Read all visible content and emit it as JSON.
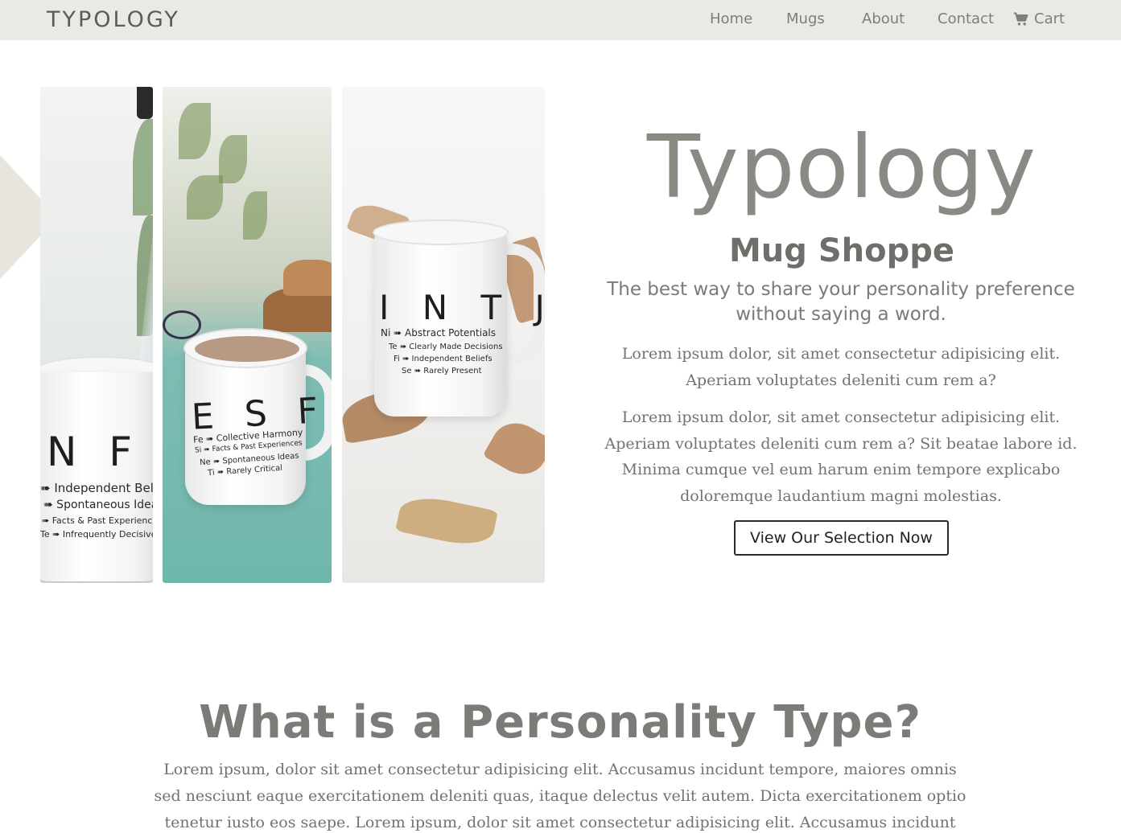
{
  "nav": {
    "brand": "TYPOLOGY",
    "links": [
      "Home",
      "Mugs",
      "About",
      "Contact"
    ],
    "cart": "Cart"
  },
  "mugs": {
    "nfp": {
      "letters": "N F P",
      "lines": [
        "➠ Independent Beliefs",
        "➠ Spontaneous Ideas",
        "➠ Facts & Past Experiences",
        "Te ➠ Infrequently Decisive"
      ]
    },
    "esfj": {
      "letters": "E S F J",
      "lines": [
        "Fe ➠ Collective Harmony",
        "Si ➠ Facts & Past Experiences",
        "Ne ➠ Spontaneous Ideas",
        "Ti ➠ Rarely Critical"
      ]
    },
    "intj": {
      "letters": "I N T J",
      "lines": [
        "Ni ➠ Abstract Potentials",
        "Te ➠ Clearly Made Decisions",
        "Fi ➠ Independent Beliefs",
        "Se ➠ Rarely Present"
      ]
    }
  },
  "hero": {
    "title": "Typology",
    "subtitle": "Mug Shoppe",
    "tagline": "The best way to share your personality preference without saying a word.",
    "paragraph1": "Lorem ipsum dolor, sit amet consectetur adipisicing elit. Aperiam voluptates deleniti cum rem a?",
    "paragraph2": "Lorem ipsum dolor, sit amet consectetur adipisicing elit. Aperiam voluptates deleniti cum rem a? Sit beatae labore id. Minima cumque vel eum harum enim tempore explicabo doloremque laudantium magni molestias.",
    "cta": "View Our Selection Now"
  },
  "section": {
    "title": "What is a Personality Type?",
    "paragraph": "Lorem ipsum, dolor sit amet consectetur adipisicing elit. Accusamus incidunt tempore, maiores omnis sed nesciunt eaque exercitationem deleniti quas, itaque delectus velit autem. Dicta exercitationem optio tenetur iusto eos saepe. Lorem ipsum, dolor sit amet consectetur adipisicing elit. Accusamus incidunt"
  },
  "colors": {
    "navbar_bg": "#ebe9e4",
    "text_gray": "#727270",
    "title_gray": "#8a8a85",
    "button_border": "#2a2a2a"
  }
}
